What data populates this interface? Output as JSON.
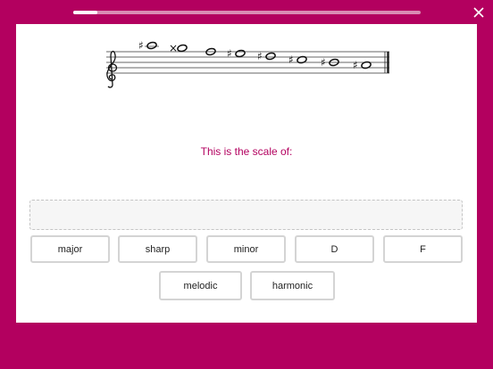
{
  "progress": {
    "fraction": 0.07
  },
  "toolbar": {
    "close_icon": "close-icon"
  },
  "score": {
    "clef": "treble-clef",
    "notes": [
      {
        "accidental": "♯"
      },
      {
        "accidental": "×"
      },
      {
        "accidental": ""
      },
      {
        "accidental": "♯"
      },
      {
        "accidental": "♯"
      },
      {
        "accidental": "♯"
      },
      {
        "accidental": "♯"
      },
      {
        "accidental": "♯"
      }
    ]
  },
  "question": {
    "prompt": "This is the scale of:"
  },
  "answer_zone": {
    "value": ""
  },
  "options": [
    {
      "label": "major"
    },
    {
      "label": "sharp"
    },
    {
      "label": "minor"
    },
    {
      "label": "D"
    },
    {
      "label": "F"
    },
    {
      "label": "melodic"
    },
    {
      "label": "harmonic"
    }
  ],
  "colors": {
    "background": "#b3005f",
    "accent": "#b3005f",
    "panel": "#ffffff"
  }
}
